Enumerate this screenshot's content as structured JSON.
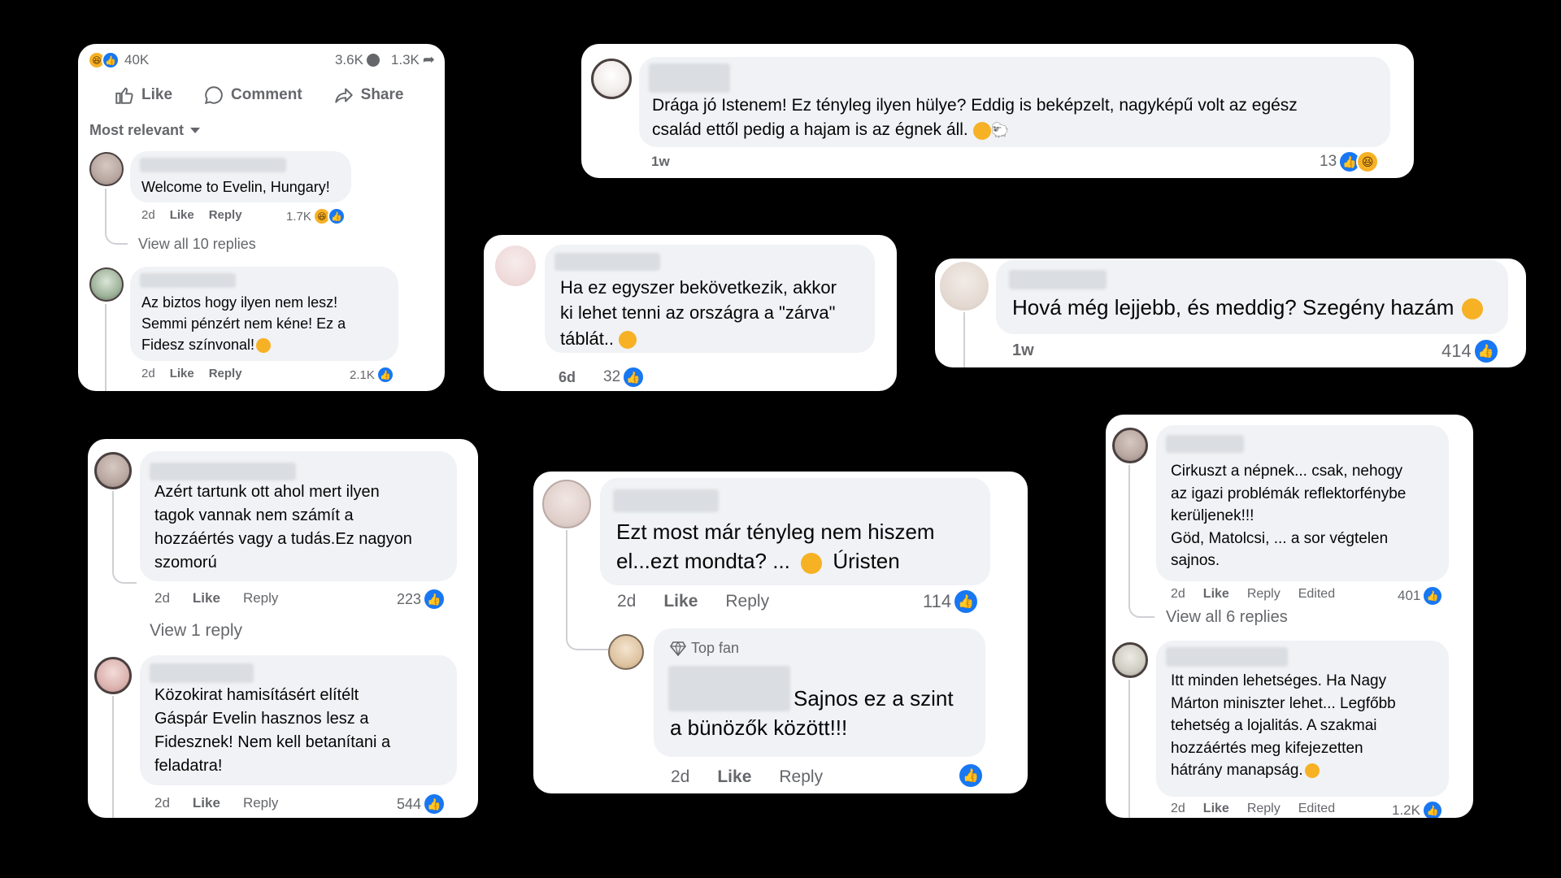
{
  "card1": {
    "reactions_total": "40K",
    "comments_count": "3.6K",
    "shares_count": "1.3K",
    "action_like": "Like",
    "action_comment": "Comment",
    "action_share": "Share",
    "sort_label": "Most relevant",
    "comments": [
      {
        "text": "Welcome to Evelin, Hungary!",
        "time": "2d",
        "like": "Like",
        "reply": "Reply",
        "count": "1.7K"
      },
      {
        "text": "Az biztos hogy ilyen nem lesz!\nSemmi pénzért nem kéne! Ez a\nFidesz színvonal!",
        "time": "2d",
        "like": "Like",
        "reply": "Reply",
        "count": "2.1K"
      }
    ],
    "view_replies": "View all 10 replies"
  },
  "card2": {
    "text": "Drága jó Istenem! Ez tényleg ilyen hülye? Eddig is beképzelt, nagyképű volt az egész\ncsalád ettől pedig a hajam is az égnek áll.",
    "time": "1w",
    "count": "13"
  },
  "card3": {
    "text": "Ha ez egyszer bekövetkezik, akkor\nki lehet tenni az országra a \"zárva\"\ntáblát..",
    "time": "6d",
    "count": "32"
  },
  "card4": {
    "text": "Hová még lejjebb, és meddig? Szegény hazám",
    "time": "1w",
    "count": "414"
  },
  "card5": {
    "comments": [
      {
        "text": "Azért tartunk ott ahol mert ilyen\ntagok vannak nem számít a\nhozzáértés vagy a tudás.Ez nagyon\nszomorú",
        "time": "2d",
        "like": "Like",
        "reply": "Reply",
        "count": "223"
      },
      {
        "text": "Közokirat hamisításért elítélt\nGáspár Evelin hasznos lesz a\nFidesznek! Nem kell betanítani a\nfeladatra!",
        "time": "2d",
        "like": "Like",
        "reply": "Reply",
        "count": "544"
      }
    ],
    "view_replies": "View 1 reply"
  },
  "card6": {
    "main": {
      "text": "Ezt most már tényleg nem hiszem\nel...ezt mondta? ...",
      "text_tail": "Úristen",
      "time": "2d",
      "like": "Like",
      "reply": "Reply",
      "count": "114"
    },
    "reply": {
      "badge": "Top fan",
      "text_a": "Sajnos ez a szint",
      "text_b": "a bünözők között!!!",
      "time": "2d",
      "like": "Like",
      "reply": "Reply"
    }
  },
  "card7": {
    "comments": [
      {
        "text": "Cirkuszt a népnek... csak, nehogy\naz igazi problémák reflektorfénybe\nkerüljenek!!!\nGöd, Matolcsi, ... a sor végtelen\nsajnos.",
        "time": "2d",
        "like": "Like",
        "reply": "Reply",
        "edited": "Edited",
        "count": "401"
      },
      {
        "text": "Itt minden lehetséges. Ha Nagy\nMárton miniszter lehet... Legfőbb\ntehetség a lojalitás. A szakmai\nhozzáértés meg kifejezetten\nhátrány manapság.",
        "time": "2d",
        "like": "Like",
        "reply": "Reply",
        "edited": "Edited",
        "count": "1.2K"
      }
    ],
    "view_replies": "View all 6 replies"
  },
  "colors": {
    "like_blue": "#1877f2",
    "haha_yellow": "#f7b125",
    "meta_gray": "#65676b",
    "bubble_bg": "#f0f2f5"
  },
  "icons": [
    "like-icon",
    "haha-icon",
    "comment-icon",
    "share-icon",
    "thumb-up-icon",
    "caret-down-icon",
    "diamond-icon",
    "sad-emoji-icon",
    "crying-emoji-icon",
    "grin-emoji-icon"
  ]
}
